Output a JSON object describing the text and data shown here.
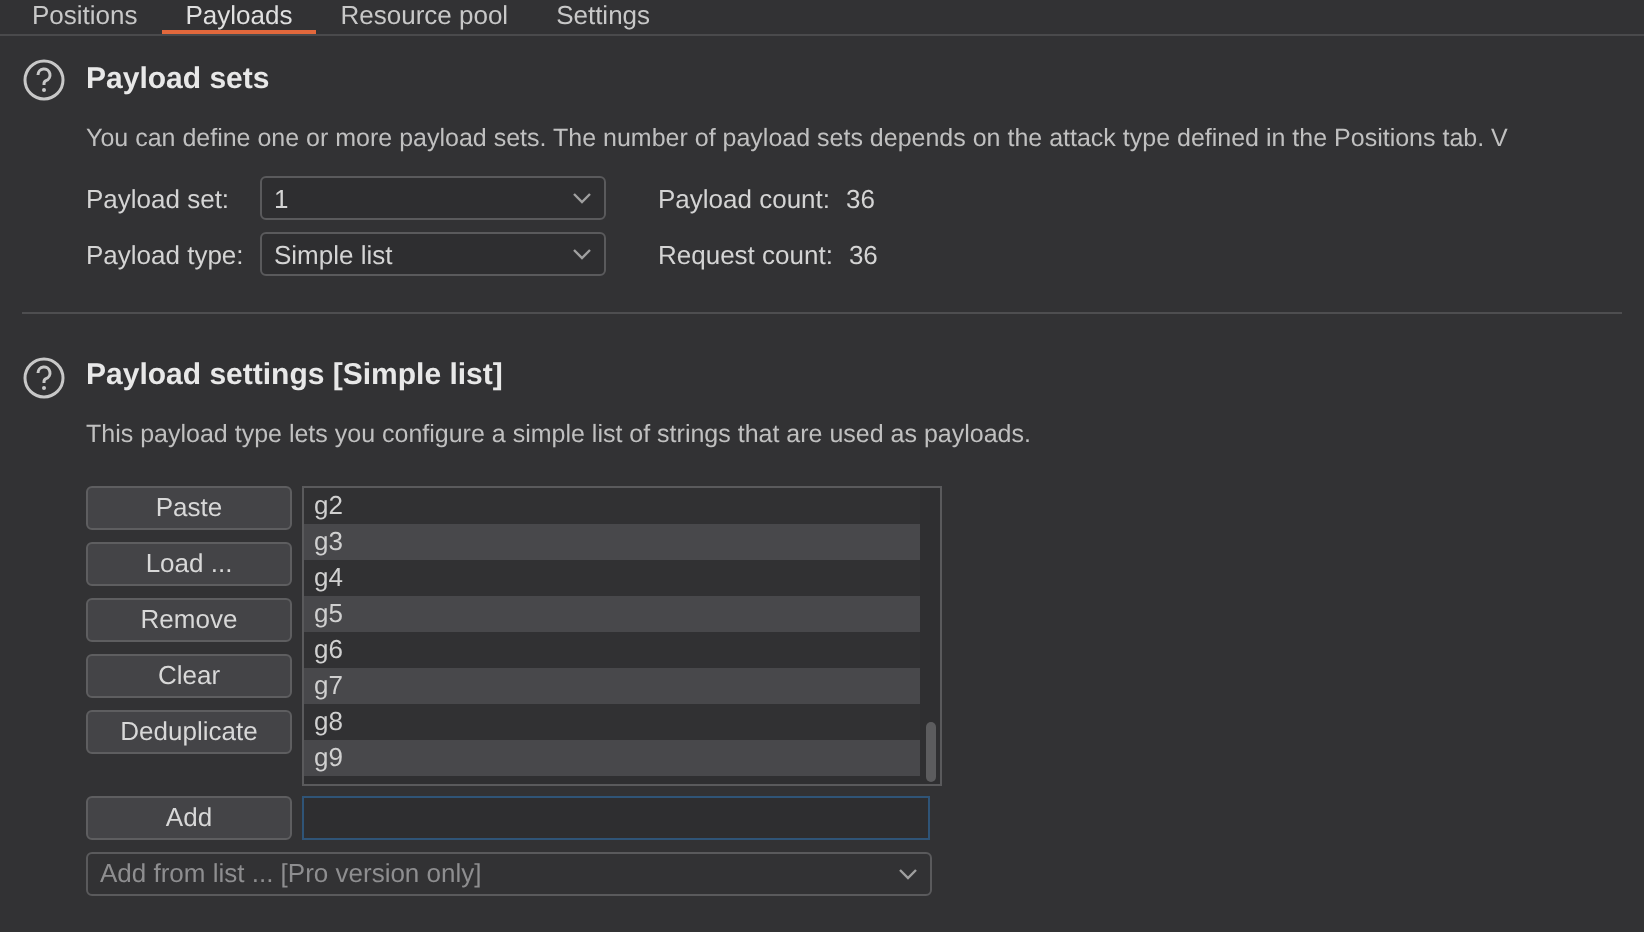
{
  "tabs": [
    {
      "label": "Positions",
      "selected": false
    },
    {
      "label": "Payloads",
      "selected": true
    },
    {
      "label": "Resource pool",
      "selected": false
    },
    {
      "label": "Settings",
      "selected": false
    }
  ],
  "payload_sets": {
    "title": "Payload sets",
    "description": "You can define one or more payload sets. The number of payload sets depends on the attack type defined in the Positions tab. V",
    "payload_set": {
      "label": "Payload set:",
      "value": "1"
    },
    "payload_type": {
      "label": "Payload type:",
      "value": "Simple list"
    },
    "payload_count": {
      "label": "Payload count:",
      "value": "36"
    },
    "request_count": {
      "label": "Request count:",
      "value": "36"
    }
  },
  "payload_settings": {
    "title": "Payload settings [Simple list]",
    "description": "This payload type lets you configure a simple list of strings that are used as payloads.",
    "buttons": [
      "Paste",
      "Load ...",
      "Remove",
      "Clear",
      "Deduplicate"
    ],
    "items": [
      "g2",
      "g3",
      "g4",
      "g5",
      "g6",
      "g7",
      "g8",
      "g9"
    ],
    "add_button": "Add",
    "add_from_list": {
      "placeholder": "Add from list ... [Pro version only]"
    }
  }
}
